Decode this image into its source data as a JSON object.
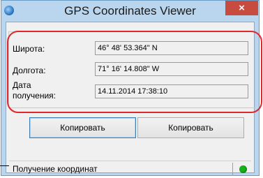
{
  "window": {
    "title": "GPS Coordinates Viewer",
    "close_label": "×"
  },
  "fields": [
    {
      "label": "Широта:",
      "value": "46° 48' 53.364\" N"
    },
    {
      "label": "Долгота:",
      "value": "71° 16' 14.808\" W"
    },
    {
      "label_line1": "Дата",
      "label_line2": "получения:",
      "value": "14.11.2014 17:38:10"
    }
  ],
  "buttons": {
    "copy1": "Копировать",
    "copy2": "Копировать"
  },
  "status": {
    "text": "Получение координат",
    "indicator_color": "#16b316",
    "indicator_icon": "status-led-icon"
  },
  "colors": {
    "highlight_outline": "#e0272b",
    "close_button": "#c74b3e",
    "window_frame": "#b9d6ee"
  }
}
